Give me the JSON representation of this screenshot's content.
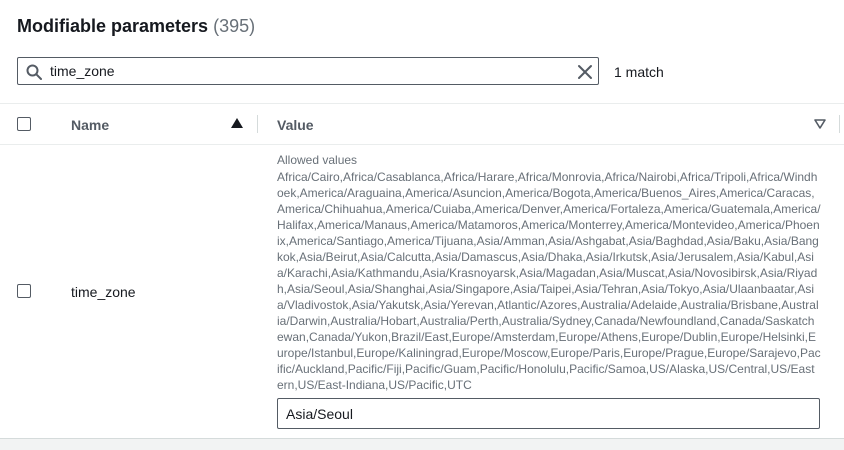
{
  "header": {
    "title": "Modifiable parameters",
    "count": "(395)"
  },
  "search": {
    "value": "time_zone",
    "placeholder": "",
    "matches": "1 match"
  },
  "table": {
    "columns": {
      "name": "Name",
      "value": "Value"
    },
    "rows": [
      {
        "name": "time_zone",
        "allowed_label": "Allowed values",
        "allowed_values": "Africa/Cairo,Africa/Casablanca,Africa/Harare,Africa/Monrovia,Africa/Nairobi,Africa/Tripoli,Africa/Windhoek,America/Araguaina,America/Asuncion,America/Bogota,America/Buenos_Aires,America/Caracas,America/Chihuahua,America/Cuiaba,America/Denver,America/Fortaleza,America/Guatemala,America/Halifax,America/Manaus,America/Matamoros,America/Monterrey,America/Montevideo,America/Phoenix,America/Santiago,America/Tijuana,Asia/Amman,Asia/Ashgabat,Asia/Baghdad,Asia/Baku,Asia/Bangkok,Asia/Beirut,Asia/Calcutta,Asia/Damascus,Asia/Dhaka,Asia/Irkutsk,Asia/Jerusalem,Asia/Kabul,Asia/Karachi,Asia/Kathmandu,Asia/Krasnoyarsk,Asia/Magadan,Asia/Muscat,Asia/Novosibirsk,Asia/Riyadh,Asia/Seoul,Asia/Shanghai,Asia/Singapore,Asia/Taipei,Asia/Tehran,Asia/Tokyo,Asia/Ulaanbaatar,Asia/Vladivostok,Asia/Yakutsk,Asia/Yerevan,Atlantic/Azores,Australia/Adelaide,Australia/Brisbane,Australia/Darwin,Australia/Hobart,Australia/Perth,Australia/Sydney,Canada/Newfoundland,Canada/Saskatchewan,Canada/Yukon,Brazil/East,Europe/Amsterdam,Europe/Athens,Europe/Dublin,Europe/Helsinki,Europe/Istanbul,Europe/Kaliningrad,Europe/Moscow,Europe/Paris,Europe/Prague,Europe/Sarajevo,Pacific/Auckland,Pacific/Fiji,Pacific/Guam,Pacific/Honolulu,Pacific/Samoa,US/Alaska,US/Central,US/Eastern,US/East-Indiana,US/Pacific,UTC",
        "value": "Asia/Seoul"
      }
    ]
  },
  "icons": {
    "search": "search-icon",
    "clear": "close-icon",
    "sort": "sort-ascending-icon",
    "filter": "caret-down-icon"
  },
  "colors": {
    "text": "#16191f",
    "muted": "#687078",
    "border": "#545b64",
    "divider": "#eaeded"
  }
}
